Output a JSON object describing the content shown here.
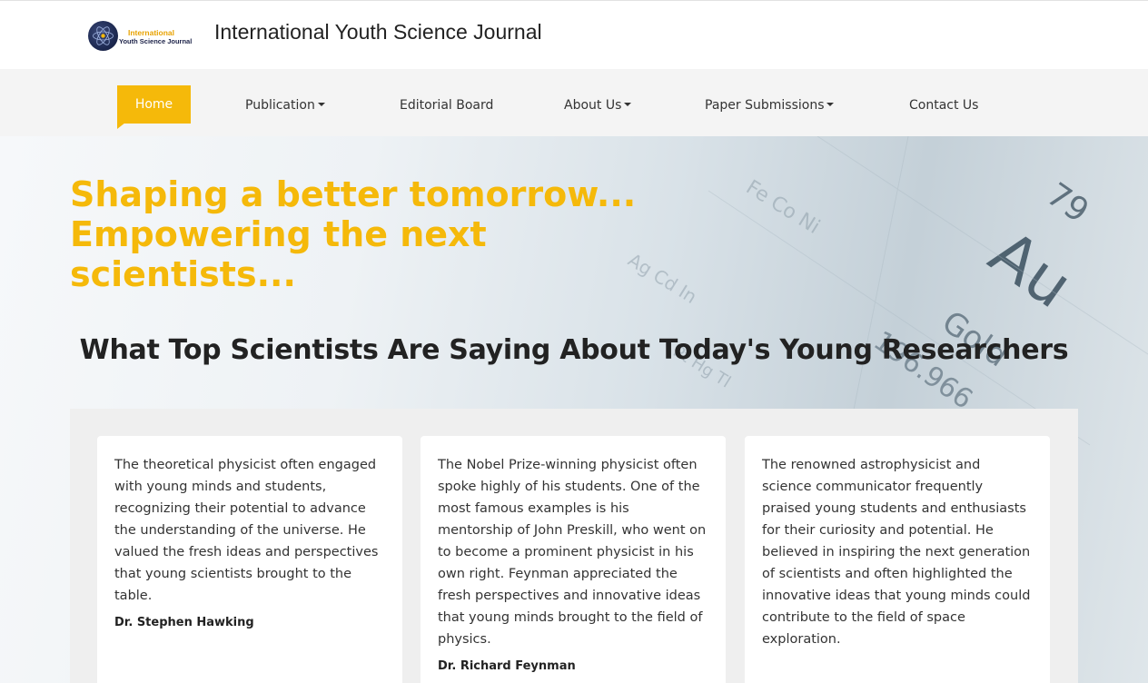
{
  "brand": {
    "logo_line1": "International",
    "logo_line2": "Youth Science Journal",
    "site_title": "International Youth Science Journal"
  },
  "nav": {
    "home": "Home",
    "publication": "Publication",
    "editorial_board": "Editorial Board",
    "about_us": "About Us",
    "paper_submissions": "Paper Submissions",
    "contact_us": "Contact Us"
  },
  "hero": {
    "heading_lines": [
      "Shaping a better tomorrow...",
      "Empowering the next",
      "scientists..."
    ],
    "section_title": "What Top Scientists Are Saying About Today's Young Researchers",
    "bg_text": {
      "number": "79",
      "symbol": "Au",
      "name": "Gold",
      "mass": "196.966"
    }
  },
  "testimonials": [
    {
      "text": "The theoretical physicist often engaged with young minds and students, recognizing their potential to advance the understanding of the universe. He valued the fresh ideas and perspectives that young scientists brought to the table.",
      "author": "Dr. Stephen Hawking"
    },
    {
      "text": "The Nobel Prize-winning physicist often spoke highly of his students. One of the most famous examples is his mentorship of John Preskill, who went on to become a prominent physicist in his own right. Feynman appreciated the fresh perspectives and innovative ideas that young minds brought to the field of physics.",
      "author": "Dr. Richard Feynman"
    },
    {
      "text": "The renowned astrophysicist and science communicator frequently praised young students and enthusiasts for their curiosity and potential. He believed in inspiring the next generation of scientists and often highlighted the innovative ideas that young minds could contribute to the field of space exploration.",
      "author": ""
    }
  ],
  "colors": {
    "accent": "#f5b90a",
    "nav_bg": "#f4f4f4",
    "panel_bg": "#efefef",
    "text_dark": "#222222"
  }
}
